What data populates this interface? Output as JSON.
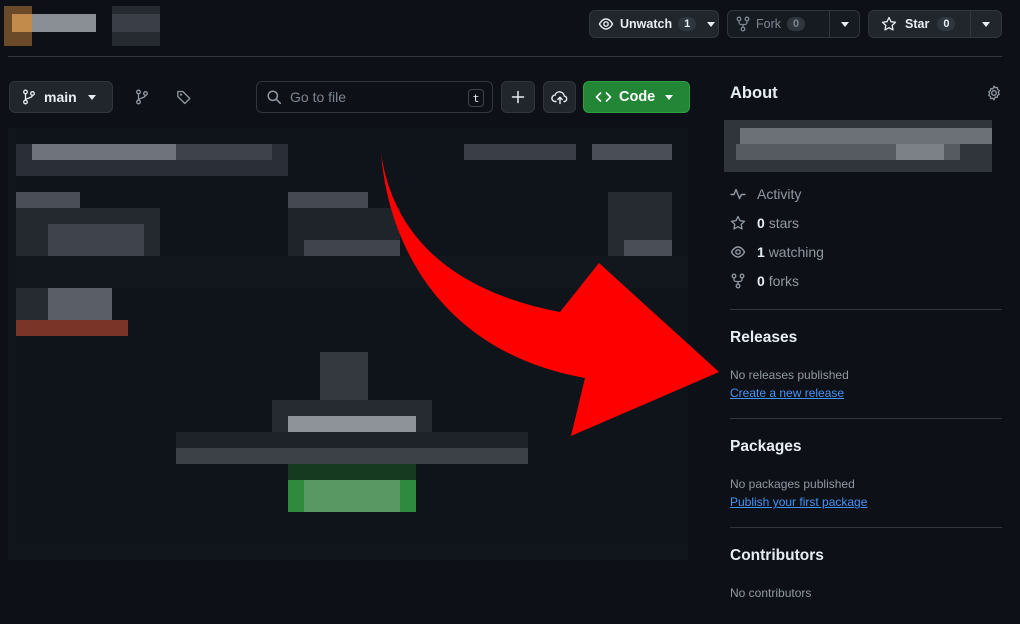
{
  "header": {
    "watch": {
      "label": "Unwatch",
      "count": "1"
    },
    "fork": {
      "label": "Fork",
      "count": "0"
    },
    "star": {
      "label": "Star",
      "count": "0"
    }
  },
  "toolbar": {
    "branch": "main",
    "search_placeholder": "Go to file",
    "search_shortcut": "t",
    "code_label": "Code"
  },
  "about": {
    "title": "About",
    "stats": [
      {
        "icon": "pulse-icon",
        "value": "",
        "label": "Activity"
      },
      {
        "icon": "star-icon",
        "value": "0",
        "label": "stars"
      },
      {
        "icon": "eye-icon",
        "value": "1",
        "label": "watching"
      },
      {
        "icon": "fork-icon",
        "value": "0",
        "label": "forks"
      }
    ]
  },
  "releases": {
    "title": "Releases",
    "empty": "No releases published",
    "link": "Create a new release"
  },
  "packages": {
    "title": "Packages",
    "empty": "No packages published",
    "link": "Publish your first package"
  },
  "contributors": {
    "title": "Contributors",
    "empty": "No contributors"
  },
  "colors": {
    "accent_green": "#238636",
    "link_blue": "#4493f8",
    "annotation_arrow": "#ff0000"
  }
}
